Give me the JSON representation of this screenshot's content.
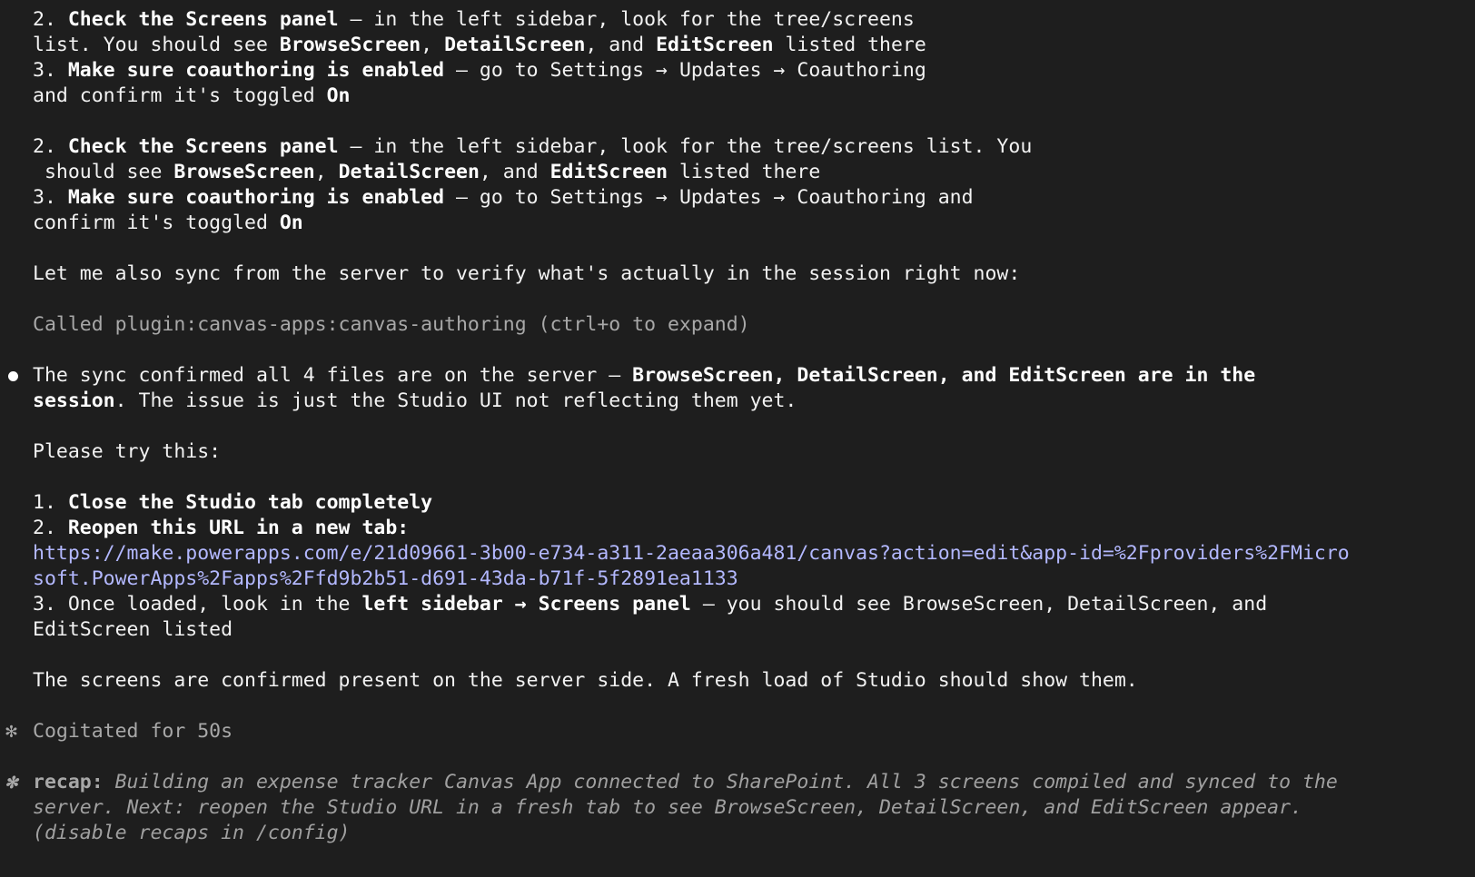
{
  "block1": {
    "item2_num": "2. ",
    "item2_bold": "Check the Screens panel",
    "item2_rest": " — in the left sidebar, look for the tree/screens",
    "item2_cont_pre": "list. You should see ",
    "browse": "BrowseScreen",
    "comma": ", ",
    "detail": "DetailScreen",
    "and": ", and ",
    "edit": "EditScreen",
    "listed_there": " listed there",
    "item3_num": "3. ",
    "item3_bold": "Make sure coauthoring is enabled",
    "item3_rest": " — go to Settings → Updates → Coauthoring",
    "item3_cont_pre": "and confirm it's toggled ",
    "on": "On"
  },
  "block2": {
    "item2_num": "2. ",
    "item2_bold": "Check the Screens panel",
    "item2_rest": " — in the left sidebar, look for the tree/screens list. You",
    "item2_cont_pre": " should see ",
    "browse": "BrowseScreen",
    "comma": ", ",
    "detail": "DetailScreen",
    "and": ", and ",
    "edit": "EditScreen",
    "listed_there": " listed there",
    "item3_num": "3. ",
    "item3_bold": "Make sure coauthoring is enabled",
    "item3_rest": " — go to Settings → Updates → Coauthoring and",
    "item3_cont_pre": "confirm it's toggled ",
    "on": "On"
  },
  "sync_line": "Let me also sync from the server to verify what's actually in the session right now:",
  "tool_call": "Called plugin:canvas-apps:canvas-authoring (ctrl+o to expand)",
  "message": {
    "pre": "The sync confirmed all 4 files are on the server — ",
    "bold1": "BrowseScreen, DetailScreen, and EditScreen are in the",
    "bold2": "session",
    "post": ". The issue is just the Studio UI not reflecting them yet.",
    "please": "Please try this:",
    "s1_num": "1. ",
    "s1_bold": "Close the Studio tab completely",
    "s2_num": "2. ",
    "s2_bold": "Reopen this URL in a new tab:",
    "url_line1": "https://make.powerapps.com/e/21d09661-3b00-e734-a311-2aeaa306a481/canvas?action=edit&app-id=%2Fproviders%2FMicro",
    "url_line2": "soft.PowerApps%2Fapps%2Ffd9b2b51-d691-43da-b71f-5f2891ea1133",
    "s3_pre": "3. Once loaded, look in the ",
    "s3_bold": "left sidebar → Screens panel",
    "s3_rest": " — you should see BrowseScreen, DetailScreen, and",
    "s3_cont": "EditScreen listed",
    "confirm": "The screens are confirmed present on the server side. A fresh load of Studio should show them."
  },
  "cogitated": "Cogitated for 50s",
  "star_glyph": "✻",
  "recap": {
    "label": "recap:",
    "line1": " Building an expense tracker Canvas App connected to SharePoint. All 3 screens compiled and synced to the",
    "line2": "server. Next: reopen the Studio URL in a fresh tab to see BrowseScreen, DetailScreen, and EditScreen appear.",
    "line3": "(disable recaps in /config)"
  },
  "colors": {
    "background": "#1e1e1e",
    "text": "#f2f2f2",
    "muted": "#a8a8a8",
    "link": "#b3b8ff"
  }
}
